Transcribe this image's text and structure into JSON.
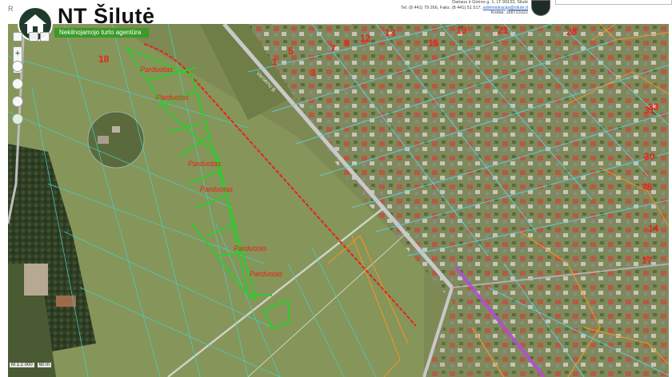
{
  "header": {
    "brand_name": "NT Šilutė",
    "brand_subtitle": "Nekilnojamojo turto agentūra",
    "corner_text": "R",
    "contact_line1": "Dariaus ir Girėno g. 1, LT 99133, Šilutė",
    "contact_line2_prefix": "Tel. (8 441) 79 266, Faks. (8 441) 51 517,",
    "contact_email": "administracija@silute.lt",
    "contact_line3": "Kodas: 188723322"
  },
  "toolbar": {
    "zoom_in": "+",
    "zoom_out": "−"
  },
  "map": {
    "street_label": "Varsėnų g.",
    "block_numbers": [
      "18",
      "19",
      "21",
      "28",
      "5",
      "7",
      "8",
      "12",
      "13",
      "15",
      "1",
      "3",
      "30",
      "31",
      "33",
      "17",
      "14",
      "28"
    ],
    "lot_labels": [
      "Parduotas",
      "Parduotas",
      "Parduotas",
      "Parduotas",
      "Parduotas",
      "Parduotas"
    ],
    "colors": {
      "boundary_red": "#e8221b",
      "lot_green": "#2ecc2e",
      "parcel_cyan": "#3fd6c8",
      "road_gray": "#b9b9b9",
      "plan_orange": "#e8932a",
      "plan_purple": "#b04fd6"
    }
  },
  "scale": {
    "ratio": "M 1:2 000",
    "distance": "60 m"
  }
}
